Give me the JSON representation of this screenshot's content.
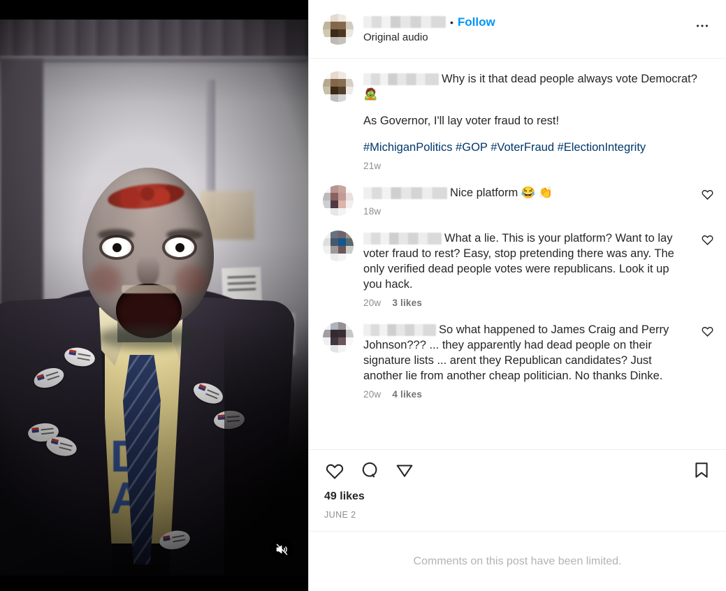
{
  "post": {
    "header": {
      "username_redacted": true,
      "separator": "•",
      "follow_label": "Follow",
      "audio_label": "Original audio",
      "more_options_label": "•••"
    },
    "caption": {
      "username_redacted": true,
      "line1": "Why is it that dead people always vote Democrat? 🧟",
      "line2": "As Governor, I'll lay voter fraud to rest!",
      "hashtags": "#MichiganPolitics #GOP #VoterFraud #ElectionIntegrity",
      "timestamp": "21w"
    },
    "comments": [
      {
        "text": "Nice platform 😂 👏",
        "timestamp": "18w",
        "likes": ""
      },
      {
        "text": "What a lie. This is your platform? Want to lay voter fraud to rest? Easy, stop pretending there was any. The only verified dead people votes were republicans. Look it up you hack.",
        "timestamp": "20w",
        "likes": "3 likes"
      },
      {
        "text": "So what happened to James Craig and Perry Johnson??? ... they apparently had dead people on their signature lists ... arent they Republican candidates? Just another lie from another cheap politician. No thanks Dinke.",
        "timestamp": "20w",
        "likes": "4 likes"
      }
    ],
    "actions": {
      "like_icon": "heart-icon",
      "comment_icon": "comment-icon",
      "share_icon": "share-icon",
      "save_icon": "bookmark-icon"
    },
    "likes_count": "49 likes",
    "date": "JUNE 2",
    "limited_notice": "Comments on this post have been limited."
  },
  "media": {
    "type": "video",
    "mute_icon": "mute-icon",
    "muted": true
  },
  "colors": {
    "link_blue": "#0095f6",
    "hashtag_blue": "#00376b",
    "primary_text": "#262626",
    "muted_text": "#8e8e8e",
    "divider": "#efefef",
    "background": "#ffffff"
  }
}
